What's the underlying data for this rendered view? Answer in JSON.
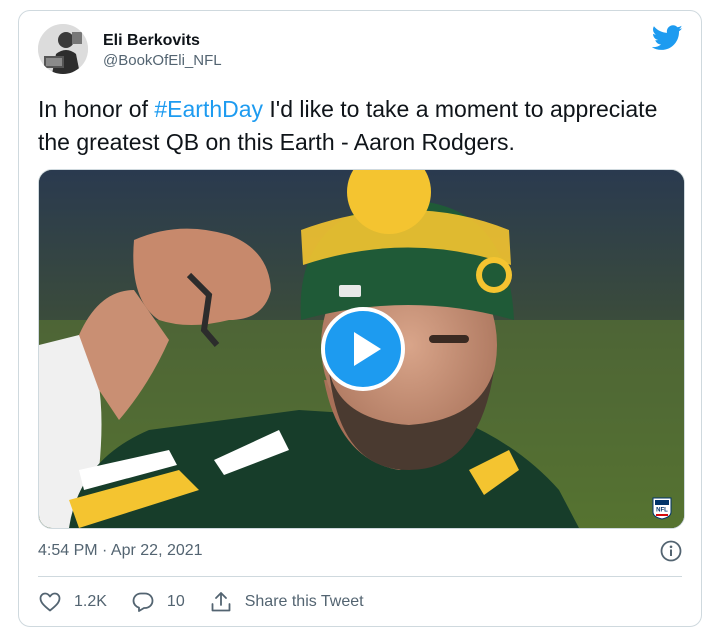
{
  "author": {
    "display_name": "Eli Berkovits",
    "handle": "@BookOfEli_NFL"
  },
  "tweet": {
    "text_before": "In honor of ",
    "hashtag": "#EarthDay",
    "text_after": " I'd like to take a moment to appreciate the greatest QB on this Earth - Aaron Rodgers."
  },
  "media": {
    "type": "video",
    "play_icon": "play-icon",
    "watermark": "NFL"
  },
  "meta": {
    "timestamp": "4:54 PM · Apr 22, 2021"
  },
  "actions": {
    "like_count": "1.2K",
    "reply_count": "10",
    "share_label": "Share this Tweet"
  },
  "colors": {
    "accent": "#1d9bf0",
    "text": "#0f1419",
    "secondary": "#536471",
    "border": "#cfd9de"
  }
}
